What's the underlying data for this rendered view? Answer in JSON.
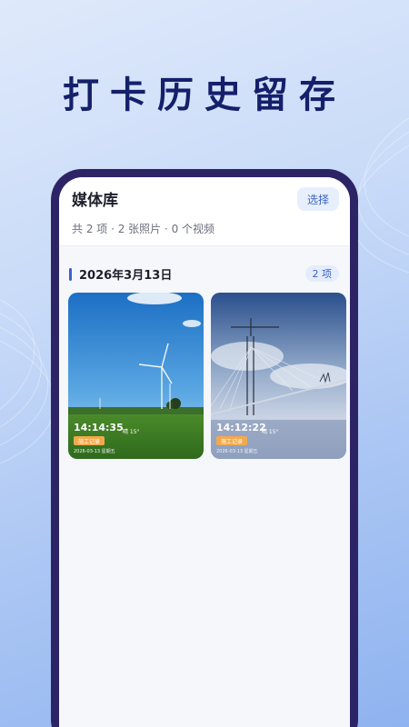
{
  "headline": "打卡历史留存",
  "app": {
    "title": "媒体库",
    "select_label": "选择",
    "summary": "共 2 项 · 2 张照片 · 0 个视频"
  },
  "section": {
    "date": "2026年3月13日",
    "count": "2 项"
  },
  "photos": [
    {
      "time": "14:14:35",
      "temp": "晴 15°",
      "tag": "施工记录",
      "sub": "2026-03-13 星期五"
    },
    {
      "time": "14:12:22",
      "temp": "晴 15°",
      "tag": "施工记录",
      "sub": "2026-03-13 星期五"
    }
  ],
  "colors": {
    "accent": "#3a63c8",
    "headline": "#15206b",
    "phone_frame": "#2d2466",
    "tag": "#f3a94a"
  }
}
